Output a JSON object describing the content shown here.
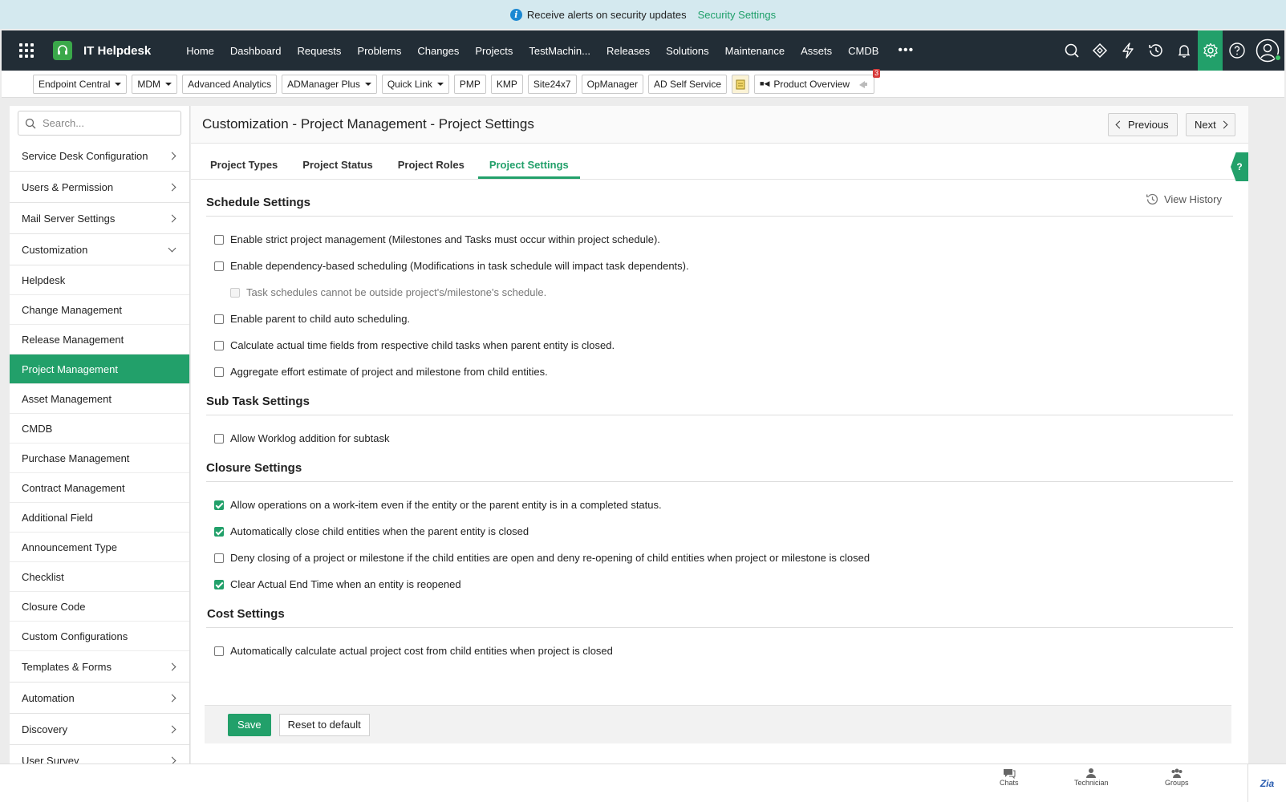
{
  "banner": {
    "text": "Receive alerts on security updates",
    "link": "Security Settings"
  },
  "app": {
    "name": "IT Helpdesk"
  },
  "nav": {
    "links": [
      "Home",
      "Dashboard",
      "Requests",
      "Problems",
      "Changes",
      "Projects",
      "TestMachin...",
      "Releases",
      "Solutions",
      "Maintenance",
      "Assets",
      "CMDB"
    ],
    "more": "•••",
    "icons": [
      "search-icon",
      "zia-icon",
      "lightning-icon",
      "history-icon",
      "bell-icon",
      "gear-icon",
      "help-icon",
      "user-avatar-icon"
    ]
  },
  "toolbar": {
    "items": [
      {
        "label": "Endpoint Central",
        "dropdown": true
      },
      {
        "label": "MDM",
        "dropdown": true
      },
      {
        "label": "Advanced Analytics",
        "dropdown": false
      },
      {
        "label": "ADManager Plus",
        "dropdown": true
      },
      {
        "label": "Quick Link",
        "dropdown": true
      },
      {
        "label": "PMP",
        "dropdown": false
      },
      {
        "label": "KMP",
        "dropdown": false
      },
      {
        "label": "Site24x7",
        "dropdown": false
      },
      {
        "label": "OpManager",
        "dropdown": false
      },
      {
        "label": "AD Self Service",
        "dropdown": false
      }
    ],
    "product_overview": "Product Overview",
    "badge_count": "3"
  },
  "sidebar": {
    "search_placeholder": "Search...",
    "top_items": [
      "Service Desk Configuration",
      "Users & Permission",
      "Mail Server Settings"
    ],
    "customization": "Customization",
    "sub_items": [
      "Helpdesk",
      "Change Management",
      "Release Management",
      "Project Management",
      "Asset Management",
      "CMDB",
      "Purchase Management",
      "Contract Management",
      "Additional Field",
      "Announcement Type",
      "Checklist",
      "Closure Code",
      "Custom Configurations"
    ],
    "bottom_items": [
      "Templates & Forms",
      "Automation",
      "Discovery",
      "User Survey"
    ]
  },
  "page": {
    "title": "Customization - Project Management - Project Settings",
    "previous": "Previous",
    "next": "Next",
    "help": "?",
    "view_history": "View History"
  },
  "tabs": [
    "Project Types",
    "Project Status",
    "Project Roles",
    "Project Settings"
  ],
  "sections": {
    "schedule": {
      "title": "Schedule Settings",
      "options": [
        {
          "label": "Enable strict project management (Milestones and Tasks must occur within project schedule).",
          "checked": false
        },
        {
          "label": "Enable dependency-based scheduling (Modifications in task schedule will impact task dependents).",
          "checked": false
        },
        {
          "label": "Task schedules cannot be outside project's/milestone's schedule.",
          "checked": false,
          "disabled": true
        },
        {
          "label": "Enable parent to child auto scheduling.",
          "checked": false
        },
        {
          "label": "Calculate actual time fields from respective child tasks when parent entity is closed.",
          "checked": false
        },
        {
          "label": "Aggregate effort estimate of project and milestone from child entities.",
          "checked": false
        }
      ]
    },
    "subtask": {
      "title": "Sub Task Settings",
      "options": [
        {
          "label": "Allow Worklog addition for subtask",
          "checked": false
        }
      ]
    },
    "closure": {
      "title": "Closure Settings",
      "options": [
        {
          "label": "Allow operations on a work-item even if the entity or the parent entity is in a completed status.",
          "checked": true
        },
        {
          "label": "Automatically close child entities when the parent entity is closed",
          "checked": true
        },
        {
          "label": "Deny closing of a project or milestone if the child entities are open and deny re-opening of child entities when project or milestone is closed",
          "checked": false
        },
        {
          "label": "Clear Actual End Time when an entity is reopened",
          "checked": true
        }
      ]
    },
    "cost": {
      "title": "Cost Settings",
      "options": [
        {
          "label": "Automatically calculate actual project cost from child entities when project is closed",
          "checked": false
        }
      ]
    }
  },
  "buttons": {
    "save": "Save",
    "reset": "Reset to default"
  },
  "bottom": {
    "chats": "Chats",
    "technician": "Technician",
    "groups": "Groups",
    "zia": "Zia"
  },
  "colors": {
    "accent": "#22a06a",
    "nav_bg": "#222d36",
    "banner_bg": "#d4e9ef"
  }
}
